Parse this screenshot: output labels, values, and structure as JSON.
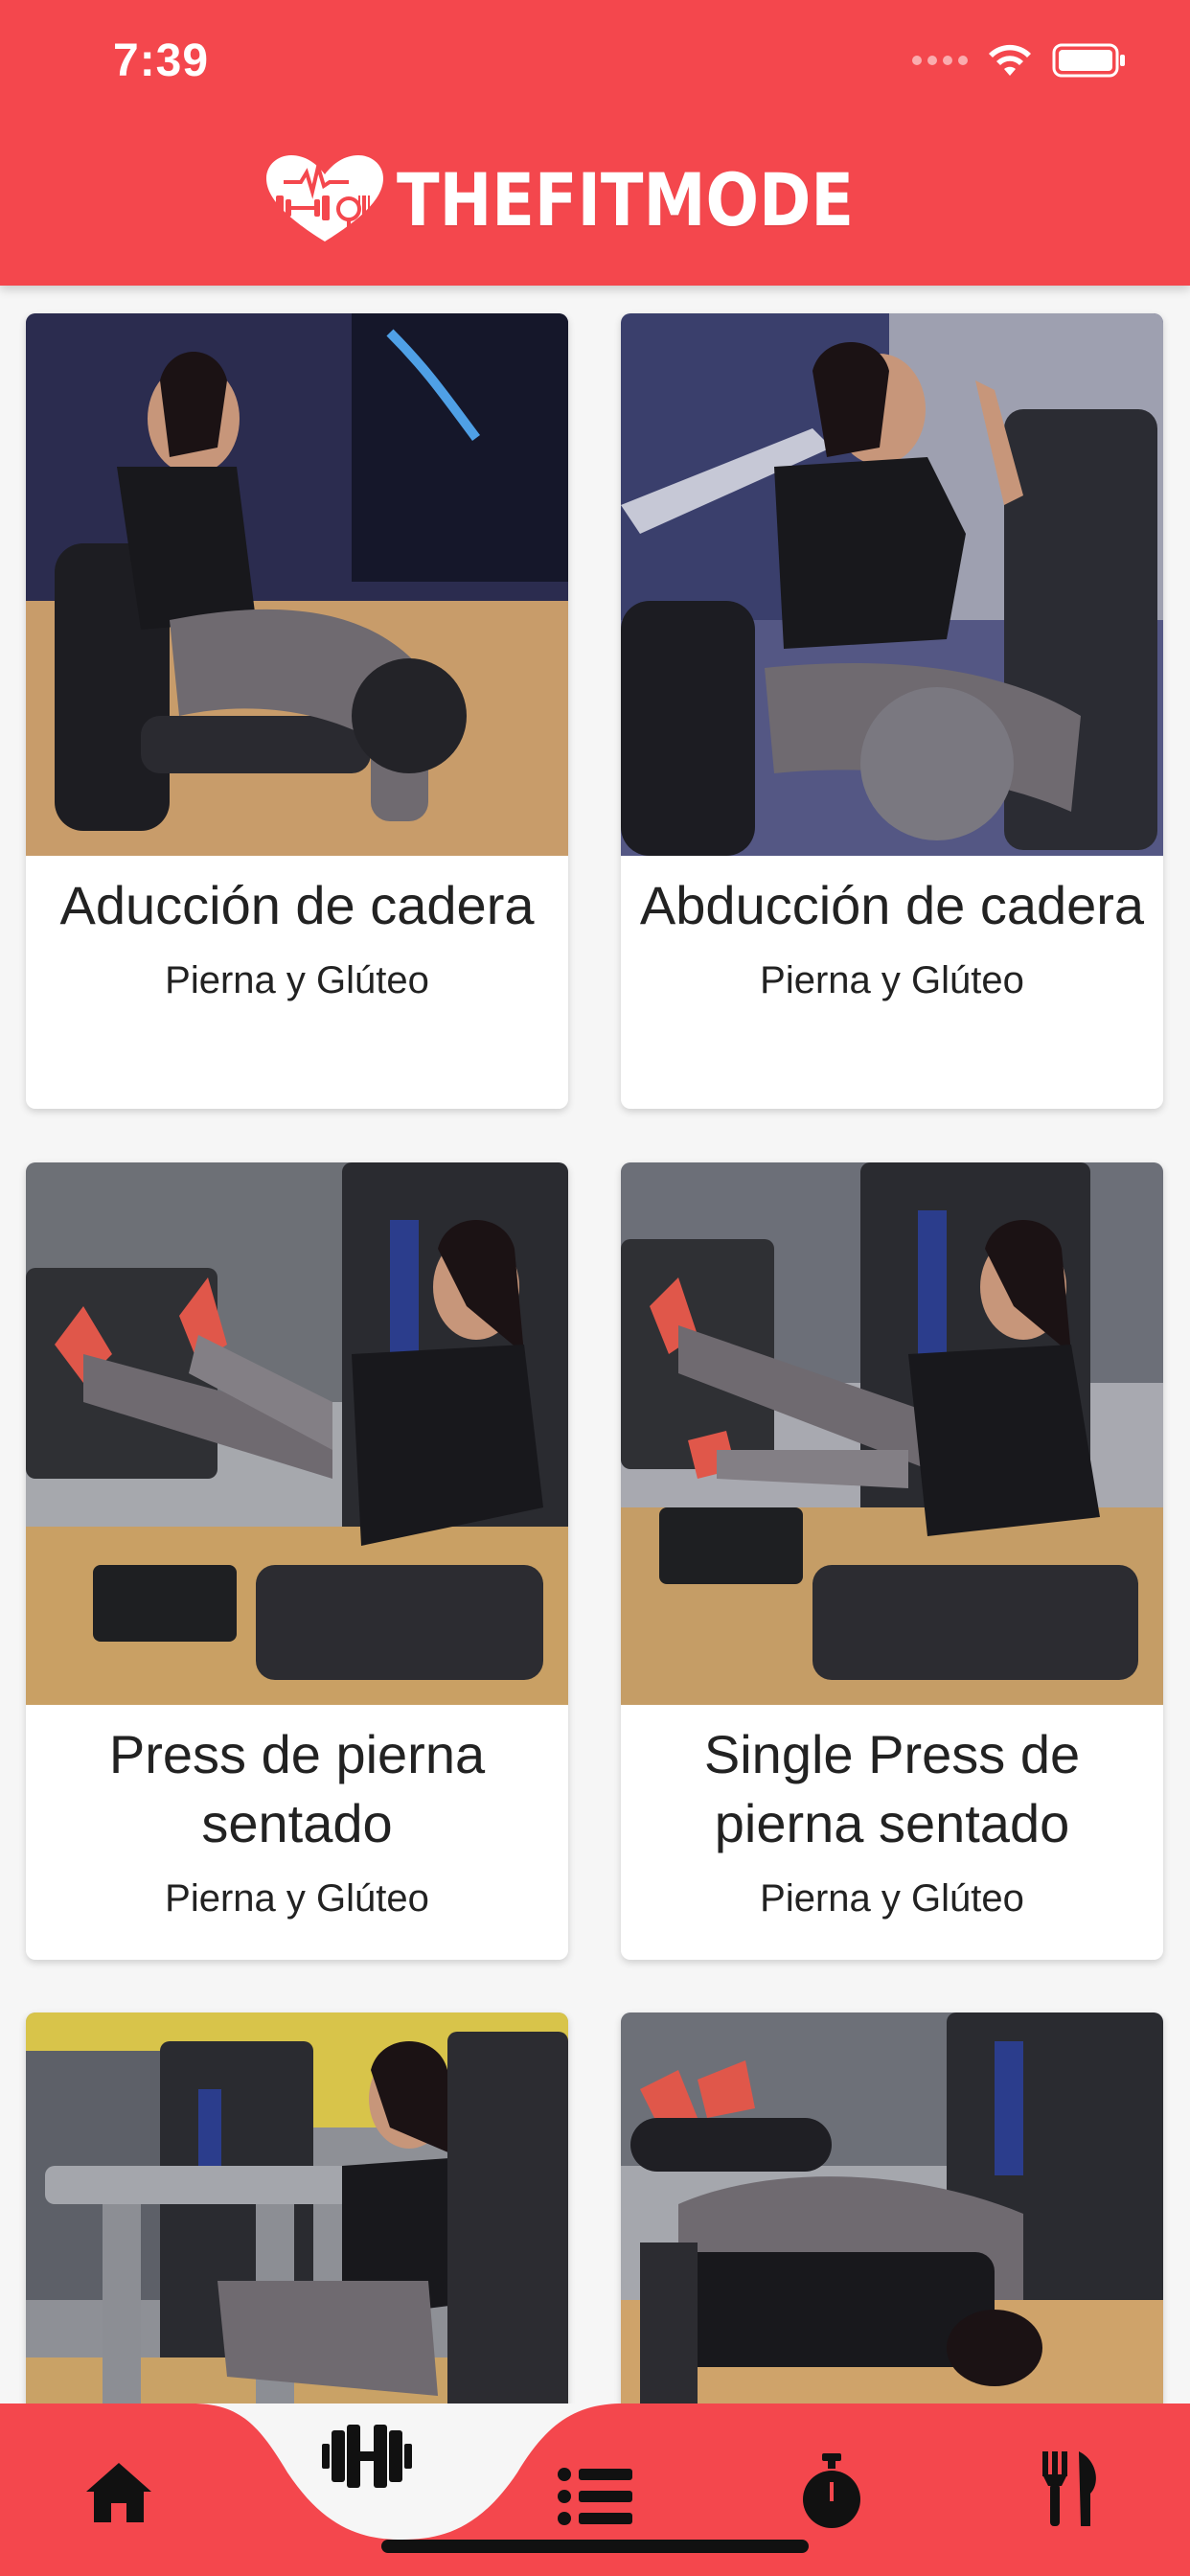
{
  "status_bar": {
    "time": "7:39"
  },
  "header": {
    "app_name": "THEFITMODE"
  },
  "cards": [
    {
      "title": "Aducción de cadera",
      "subtitle": "Pierna y Glúteo"
    },
    {
      "title": "Abducción de cadera",
      "subtitle": "Pierna y Glúteo"
    },
    {
      "title_line1": "Press de pierna",
      "title_line2": "sentado",
      "subtitle": "Pierna y Glúteo"
    },
    {
      "title_line1": "Single Press de",
      "title_line2": "pierna sentado",
      "subtitle": "Pierna y Glúteo"
    },
    {
      "title": "",
      "subtitle": ""
    },
    {
      "title": "",
      "subtitle": ""
    }
  ],
  "bottom_nav": {
    "items": [
      {
        "icon": "home-icon"
      },
      {
        "icon": "dumbbell-icon",
        "active": true
      },
      {
        "icon": "list-icon"
      },
      {
        "icon": "stopwatch-icon"
      },
      {
        "icon": "fork-knife-icon"
      }
    ]
  },
  "colors": {
    "primary": "#f4474d",
    "card_bg": "#ffffff",
    "text": "#222222"
  }
}
